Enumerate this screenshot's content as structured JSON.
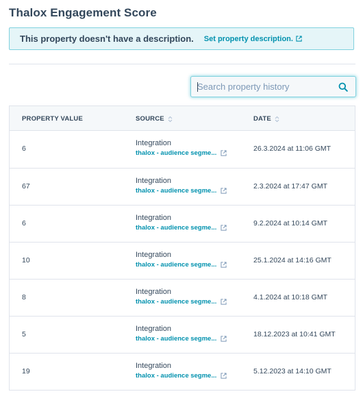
{
  "header": {
    "title": "Thalox Engagement Score"
  },
  "description_box": {
    "text": "This property doesn't have a description.",
    "link_label": "Set property description."
  },
  "search": {
    "placeholder": "Search property history",
    "value": ""
  },
  "table": {
    "columns": {
      "value": "PROPERTY VALUE",
      "source": "SOURCE",
      "date": "DATE"
    },
    "rows": [
      {
        "value": "6",
        "source_type": "Integration",
        "source_name": "thalox - audience segme...",
        "date": "26.3.2024 at 11:06 GMT"
      },
      {
        "value": "67",
        "source_type": "Integration",
        "source_name": "thalox - audience segme...",
        "date": "2.3.2024 at 17:47 GMT"
      },
      {
        "value": "6",
        "source_type": "Integration",
        "source_name": "thalox - audience segme...",
        "date": "9.2.2024 at 10:14 GMT"
      },
      {
        "value": "10",
        "source_type": "Integration",
        "source_name": "thalox - audience segme...",
        "date": "25.1.2024 at 14:16 GMT"
      },
      {
        "value": "8",
        "source_type": "Integration",
        "source_name": "thalox - audience segme...",
        "date": "4.1.2024 at 10:18 GMT"
      },
      {
        "value": "5",
        "source_type": "Integration",
        "source_name": "thalox - audience segme...",
        "date": "18.12.2023 at 10:41 GMT"
      },
      {
        "value": "19",
        "source_type": "Integration",
        "source_name": "thalox - audience segme...",
        "date": "5.12.2023 at 14:10 GMT"
      }
    ]
  },
  "icons": {
    "external_link": "external-link-icon",
    "search": "search-icon",
    "sort": "sort-icon"
  },
  "colors": {
    "text": "#33475b",
    "link": "#0091ae",
    "info_bg": "#e5f5f8",
    "info_border": "#7fd1de",
    "border": "#dfe3eb",
    "header_bg": "#f5f8fa"
  }
}
